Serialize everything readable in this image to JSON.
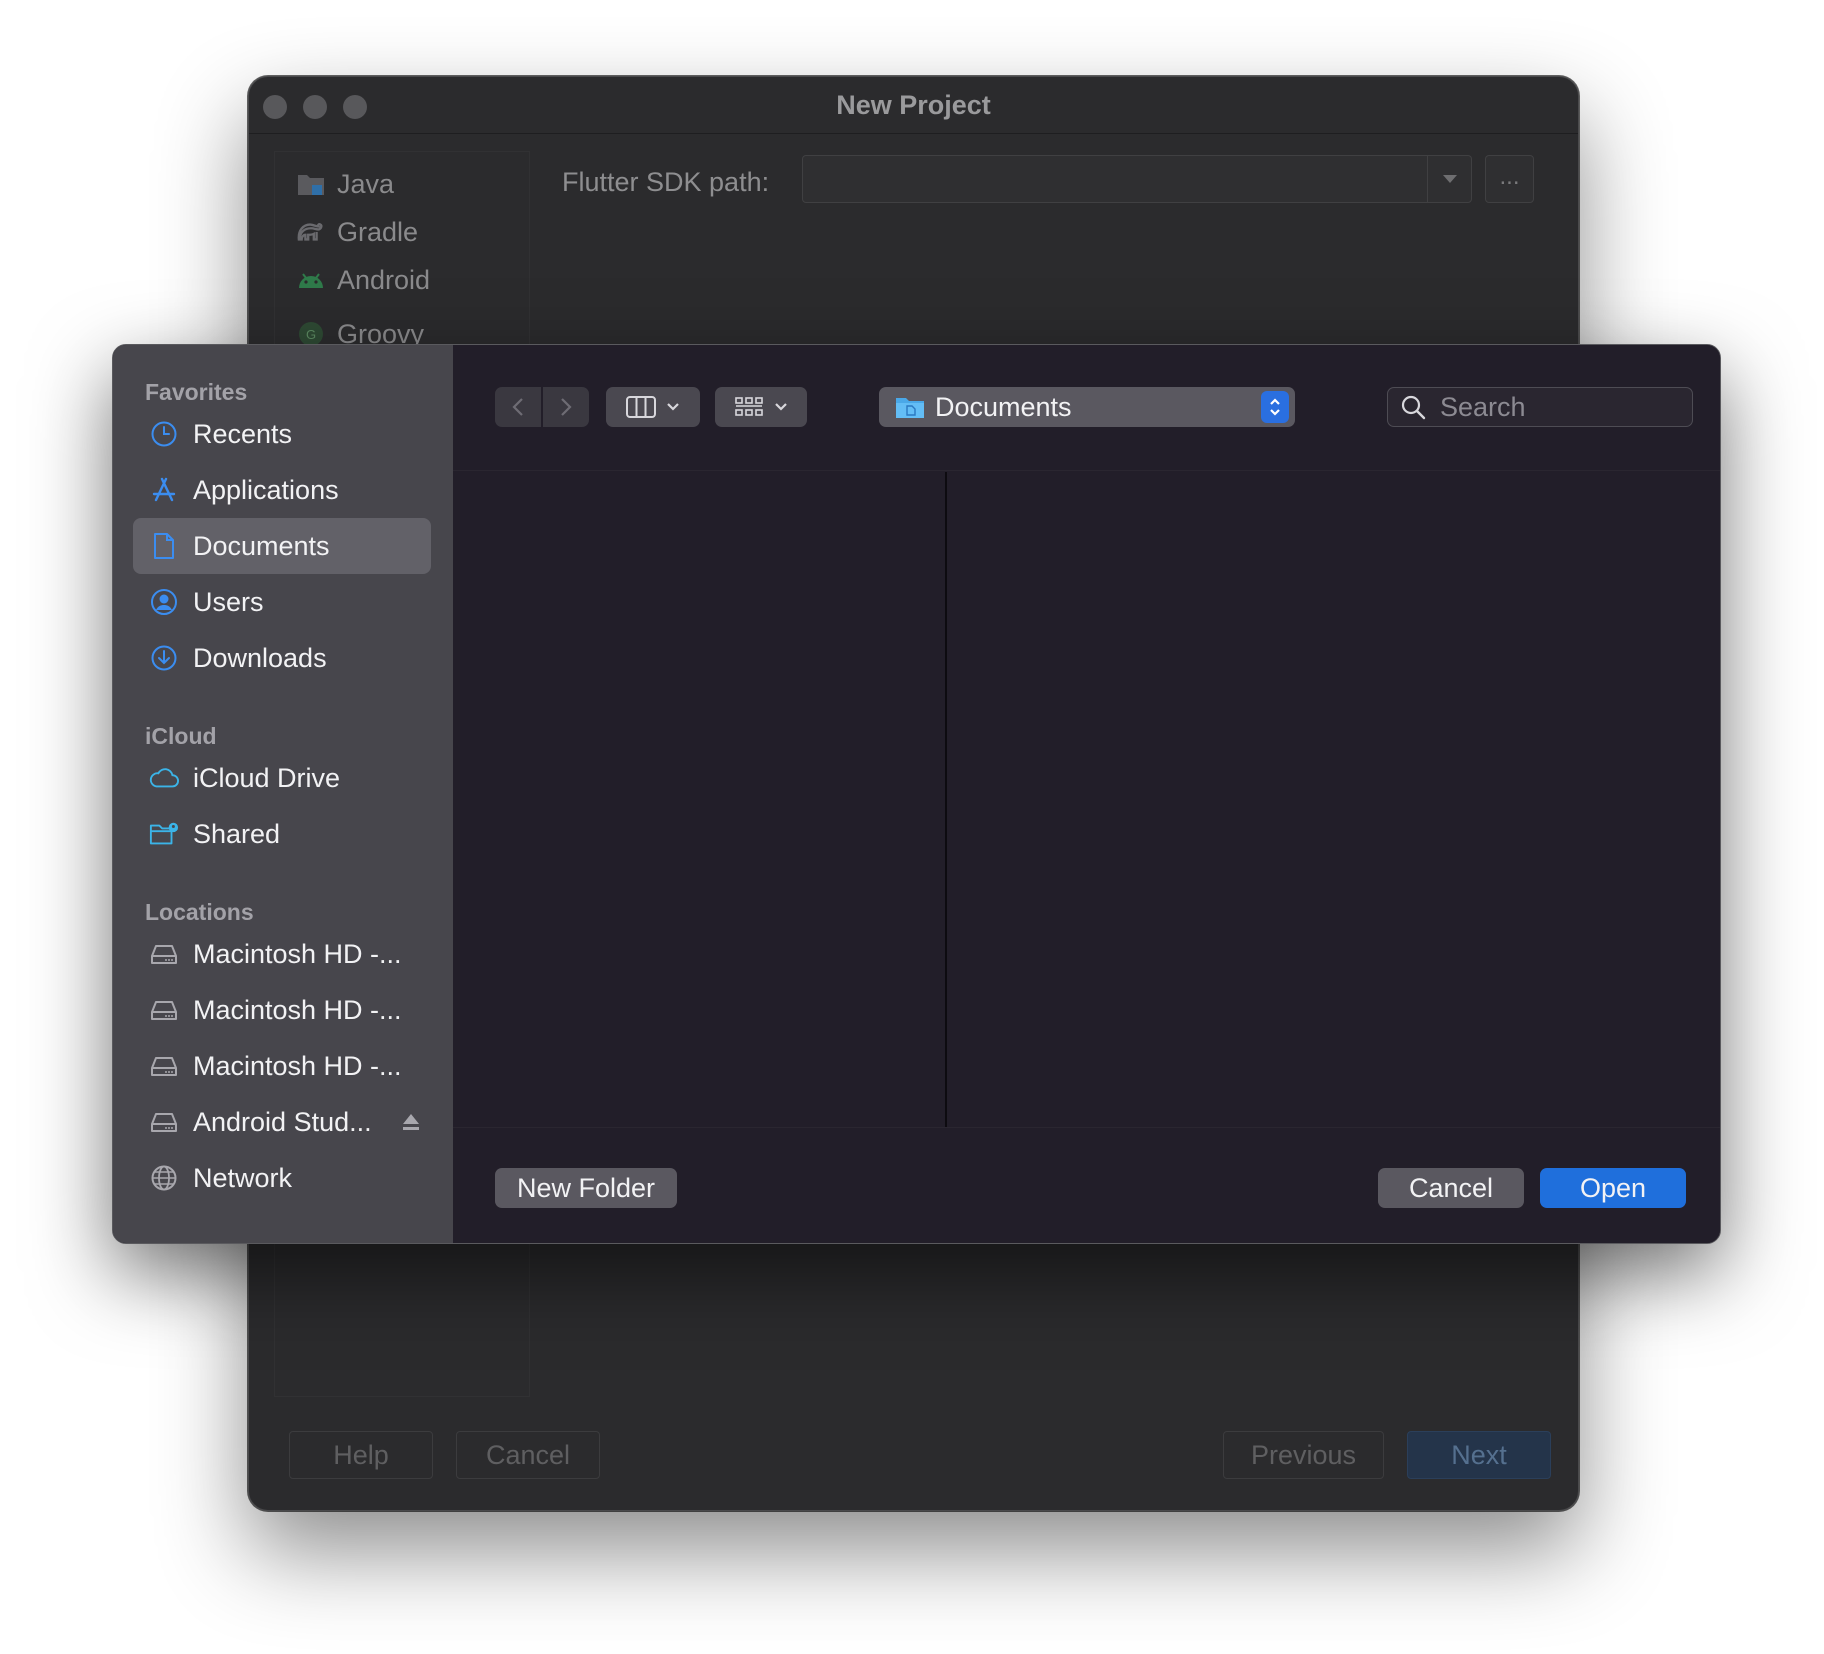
{
  "background_window": {
    "title": "New Project",
    "sidebar": [
      {
        "label": "Java",
        "icon": "folder-icon"
      },
      {
        "label": "Gradle",
        "icon": "gradle-icon"
      },
      {
        "label": "Android",
        "icon": "android-icon"
      },
      {
        "label": "Groovy",
        "icon": "groovy-icon"
      }
    ],
    "sdk_label": "Flutter SDK path:",
    "sdk_value": "",
    "browse_label": "...",
    "buttons": {
      "help": "Help",
      "cancel": "Cancel",
      "previous": "Previous",
      "next": "Next"
    }
  },
  "dialog": {
    "sections": {
      "favorites": {
        "title": "Favorites",
        "items": [
          {
            "label": "Recents",
            "icon": "clock-icon"
          },
          {
            "label": "Applications",
            "icon": "applications-icon"
          },
          {
            "label": "Documents",
            "icon": "document-icon",
            "selected": true
          },
          {
            "label": "Users",
            "icon": "user-icon"
          },
          {
            "label": "Downloads",
            "icon": "download-icon"
          }
        ]
      },
      "icloud": {
        "title": "iCloud",
        "items": [
          {
            "label": "iCloud Drive",
            "icon": "cloud-icon"
          },
          {
            "label": "Shared",
            "icon": "shared-folder-icon"
          }
        ]
      },
      "locations": {
        "title": "Locations",
        "items": [
          {
            "label": "Macintosh HD -...",
            "icon": "disk-icon"
          },
          {
            "label": "Macintosh HD -...",
            "icon": "disk-icon"
          },
          {
            "label": "Macintosh HD -...",
            "icon": "disk-icon"
          },
          {
            "label": "Android Stud...",
            "icon": "disk-icon",
            "eject": true
          },
          {
            "label": "Network",
            "icon": "globe-icon"
          }
        ]
      }
    },
    "toolbar": {
      "location": "Documents",
      "search_placeholder": "Search"
    },
    "footer": {
      "new_folder": "New Folder",
      "cancel": "Cancel",
      "open": "Open"
    },
    "colors": {
      "accent": "#1f6fdc",
      "selection": "#626168",
      "sidebar_bg": "#47464c",
      "content_bg": "#221e29"
    }
  }
}
